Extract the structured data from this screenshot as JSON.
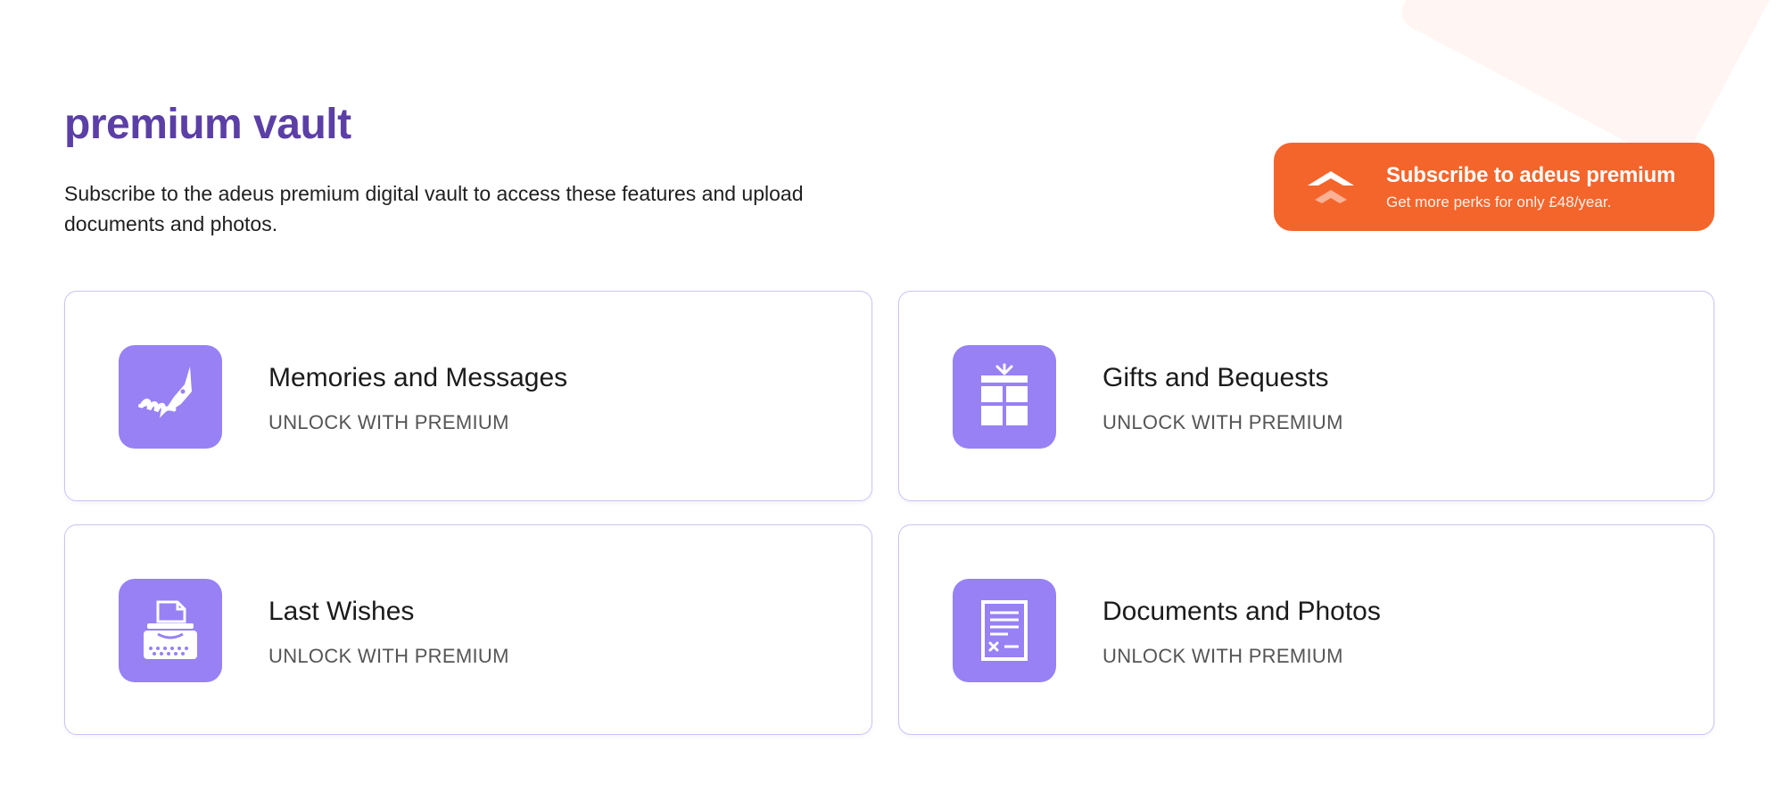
{
  "header": {
    "title": "premium vault",
    "description": "Subscribe to the adeus premium digital vault to access these features and upload documents and photos."
  },
  "subscribe": {
    "title": "Subscribe to adeus premium",
    "subtitle": "Get more perks for only  £48/year.",
    "icon": "double-chevron-up-icon",
    "color": "#f4652c"
  },
  "features": [
    {
      "title": "Memories and Messages",
      "status": "UNLOCK WITH PREMIUM",
      "icon": "fountain-pen-signature-icon"
    },
    {
      "title": "Gifts and Bequests",
      "status": "UNLOCK WITH PREMIUM",
      "icon": "gift-icon"
    },
    {
      "title": "Last Wishes",
      "status": "UNLOCK WITH PREMIUM",
      "icon": "typewriter-icon"
    },
    {
      "title": "Documents and Photos",
      "status": "UNLOCK WITH PREMIUM",
      "icon": "document-icon"
    }
  ],
  "colors": {
    "accent": "#5b3fa6",
    "icon_tile": "#9781f5",
    "card_border": "#c9c3f5"
  }
}
